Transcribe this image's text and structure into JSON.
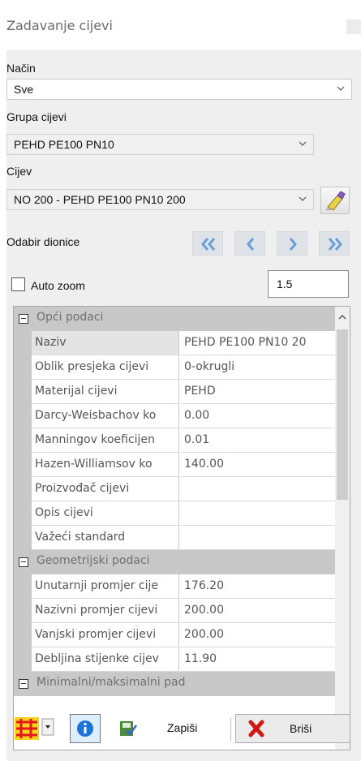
{
  "window": {
    "title": "Zadavanje cijevi"
  },
  "mode": {
    "label": "Način",
    "value": "Sve"
  },
  "pipe_group": {
    "label": "Grupa cijevi",
    "value": "PEHD PE100 PN10"
  },
  "pipe": {
    "label": "Cijev",
    "value": "NO 200 - PEHD PE100 PN10 200"
  },
  "section": {
    "label": "Odabir dionice"
  },
  "auto_zoom": {
    "label": "Auto zoom",
    "checked": false,
    "value": "1.5"
  },
  "properties": {
    "rows": [
      {
        "type": "category",
        "label": "Opći podaci"
      },
      {
        "type": "prop",
        "name": "Naziv",
        "value": "PEHD PE100 PN10 20"
      },
      {
        "type": "prop",
        "name": "Oblik presjeka cijevi",
        "value": "0-okrugli"
      },
      {
        "type": "prop",
        "name": "Materijal cijevi",
        "value": "PEHD"
      },
      {
        "type": "prop",
        "name": "Darcy-Weisbachov ko",
        "value": "0.00"
      },
      {
        "type": "prop",
        "name": "Manningov koeficijen",
        "value": "0.01"
      },
      {
        "type": "prop",
        "name": "Hazen-Williamsov ko",
        "value": "140.00"
      },
      {
        "type": "prop",
        "name": "Proizvođač cijevi",
        "value": ""
      },
      {
        "type": "prop",
        "name": "Opis cijevi",
        "value": ""
      },
      {
        "type": "prop",
        "name": "Važeći standard",
        "value": ""
      },
      {
        "type": "category",
        "label": "Geometrijski podaci"
      },
      {
        "type": "prop",
        "name": "Unutarnji promjer cije",
        "value": "176.20"
      },
      {
        "type": "prop",
        "name": "Nazivni promjer cijevi",
        "value": "200.00"
      },
      {
        "type": "prop",
        "name": "Vanjski promjer cijevi",
        "value": "200.00"
      },
      {
        "type": "prop",
        "name": "Debljina stijenke cijev",
        "value": "11.90"
      },
      {
        "type": "category",
        "label": "Minimalni/maksimalni pad"
      }
    ]
  },
  "toolbar": {
    "save_label": "Zapiši",
    "delete_label": "Briši"
  },
  "colors": {
    "nav_arrow": "#6a9fd8",
    "category_bg": "#c8c8c8",
    "info_blue": "#1e73d8",
    "delete_red": "#d01818"
  }
}
